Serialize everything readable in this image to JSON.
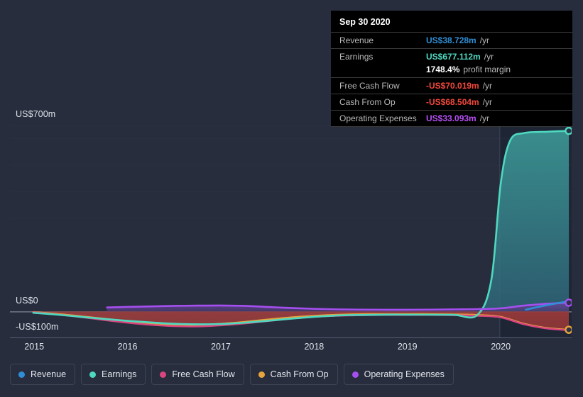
{
  "tooltip": {
    "date": "Sep 30 2020",
    "rows": [
      {
        "label": "Revenue",
        "value": "US$38.728m",
        "unit": "/yr",
        "color": "#2f8ed6"
      },
      {
        "label": "Earnings",
        "value": "US$677.112m",
        "unit": "/yr",
        "color": "#4fd8c0"
      },
      {
        "label": "",
        "value": "1748.4%",
        "unit": "profit margin",
        "color": "#ffffff"
      },
      {
        "label": "Free Cash Flow",
        "value": "-US$70.019m",
        "unit": "/yr",
        "color": "#f4483c"
      },
      {
        "label": "Cash From Op",
        "value": "-US$68.504m",
        "unit": "/yr",
        "color": "#f4483c"
      },
      {
        "label": "Operating Expenses",
        "value": "US$33.093m",
        "unit": "/yr",
        "color": "#b84ff5"
      }
    ]
  },
  "legend": {
    "items": [
      {
        "label": "Revenue",
        "color": "#2f8ed6"
      },
      {
        "label": "Earnings",
        "color": "#4fd8c0"
      },
      {
        "label": "Free Cash Flow",
        "color": "#d9457f"
      },
      {
        "label": "Cash From Op",
        "color": "#e8a33d"
      },
      {
        "label": "Operating Expenses",
        "color": "#a64ff0"
      }
    ]
  },
  "chart_data": {
    "type": "area",
    "title": "",
    "xlabel": "",
    "ylabel": "",
    "grid": true,
    "legend_position": "bottom-left",
    "background": "#272d3d",
    "currency": "US$",
    "units": "millions per year",
    "ylim": [
      -100,
      700
    ],
    "yticks": [
      700,
      0,
      -100
    ],
    "ytick_labels": [
      "US$700m",
      "US$0",
      "-US$100m"
    ],
    "gridline_values": [
      700,
      650,
      550,
      450,
      350,
      0
    ],
    "x": [
      "2015",
      "2016",
      "2017",
      "2018",
      "2019",
      "2020"
    ],
    "xlim": [
      "2014.74",
      "2020.76"
    ],
    "forecast_start": "2019.99",
    "series": [
      {
        "name": "Revenue",
        "color": "#2f8ed6",
        "x": [
          2020.27,
          2020.5,
          2020.73
        ],
        "values": [
          7.0,
          24.0,
          38.728
        ]
      },
      {
        "name": "Earnings",
        "color": "#4fd8c0",
        "x": [
          2014.99,
          2015.25,
          2015.5,
          2015.75,
          2016.0,
          2016.25,
          2016.5,
          2016.75,
          2017.0,
          2017.25,
          2017.5,
          2017.75,
          2018.0,
          2018.25,
          2018.5,
          2018.75,
          2019.0,
          2019.25,
          2019.5,
          2019.75,
          2019.9,
          2020.0,
          2020.1,
          2020.25,
          2020.5,
          2020.73
        ],
        "values": [
          -5.0,
          -12.0,
          -20.0,
          -28.0,
          -35.0,
          -41.0,
          -46.0,
          -48.0,
          -47.0,
          -42.0,
          -35.0,
          -27.0,
          -20.0,
          -15.0,
          -13.0,
          -12.0,
          -12.0,
          -12.0,
          -12.5,
          -13.0,
          120.0,
          480.0,
          640.0,
          669.0,
          674.0,
          677.112
        ]
      },
      {
        "name": "Free Cash Flow",
        "color": "#d9457f",
        "x": [
          2014.99,
          2015.25,
          2015.5,
          2015.75,
          2016.0,
          2016.25,
          2016.5,
          2016.75,
          2017.0,
          2017.25,
          2017.5,
          2017.75,
          2018.0,
          2018.25,
          2018.5,
          2018.75,
          2019.0,
          2019.25,
          2019.5,
          2019.75,
          2020.0,
          2020.25,
          2020.5,
          2020.73
        ],
        "values": [
          -3.0,
          -11.0,
          -21.0,
          -32.0,
          -42.0,
          -50.0,
          -55.0,
          -56.0,
          -52.0,
          -45.0,
          -36.0,
          -27.0,
          -20.0,
          -16.0,
          -14.0,
          -13.0,
          -13.0,
          -13.0,
          -14.0,
          -16.0,
          -22.0,
          -48.0,
          -64.0,
          -70.019
        ]
      },
      {
        "name": "Cash From Op",
        "color": "#e8a33d",
        "x": [
          2014.99,
          2015.25,
          2015.5,
          2015.75,
          2016.0,
          2016.25,
          2016.5,
          2016.75,
          2017.0,
          2017.25,
          2017.5,
          2017.75,
          2018.0,
          2018.25,
          2018.5,
          2018.75,
          2019.0,
          2019.25,
          2019.5,
          2019.75,
          2020.0,
          2020.25,
          2020.5,
          2020.73
        ],
        "values": [
          -2.0,
          -9.0,
          -18.0,
          -27.0,
          -36.0,
          -44.0,
          -49.0,
          -50.0,
          -46.0,
          -39.0,
          -30.0,
          -22.0,
          -16.0,
          -12.0,
          -10.0,
          -10.0,
          -10.0,
          -10.0,
          -11.0,
          -13.0,
          -20.0,
          -46.0,
          -62.0,
          -68.504
        ]
      },
      {
        "name": "Operating Expenses",
        "color": "#a64ff0",
        "x": [
          2015.78,
          2016.0,
          2016.25,
          2016.5,
          2016.75,
          2017.0,
          2017.25,
          2017.5,
          2017.75,
          2018.0,
          2018.25,
          2018.5,
          2018.75,
          2019.0,
          2019.25,
          2019.5,
          2019.75,
          2020.0,
          2020.25,
          2020.5,
          2020.73
        ],
        "values": [
          15.0,
          17.0,
          19.0,
          21.0,
          22.0,
          22.5,
          21.0,
          17.0,
          13.0,
          10.0,
          8.0,
          7.0,
          6.5,
          6.5,
          7.0,
          8.0,
          9.0,
          12.0,
          22.0,
          29.0,
          33.093
        ]
      }
    ]
  }
}
